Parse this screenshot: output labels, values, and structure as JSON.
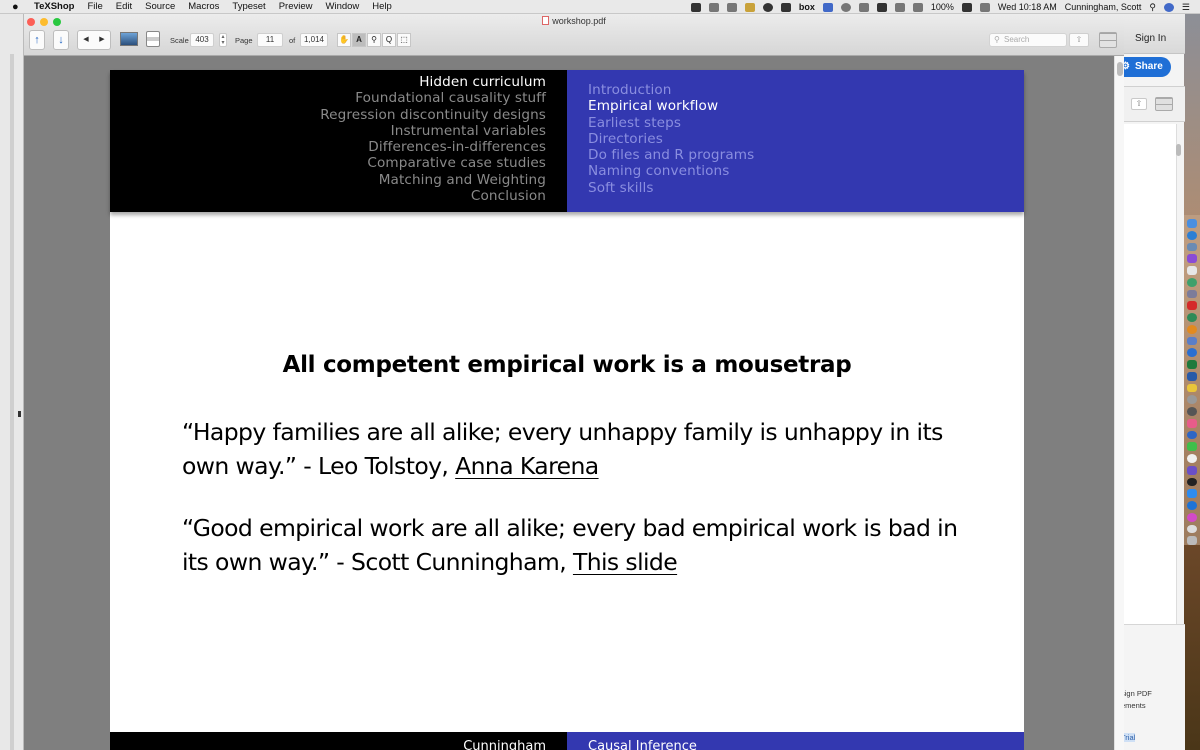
{
  "menubar": {
    "apple": "",
    "app_name": "TeXShop",
    "items": [
      "File",
      "Edit",
      "Source",
      "Macros",
      "Typeset",
      "Preview",
      "Window",
      "Help"
    ],
    "battery": "100%",
    "clock": "Wed 10:18 AM",
    "user": "Cunningham, Scott",
    "box_label": "box"
  },
  "window": {
    "title": "workshop.pdf",
    "toolbar": {
      "scale_label": "Scale",
      "scale_value": "403",
      "page_label": "Page",
      "page_value": "11",
      "of_label": "of",
      "page_total": "1,014",
      "search_placeholder": "Search",
      "prev_glyph": "◀",
      "next_glyph": "▶",
      "up_glyph": "↑",
      "down_glyph": "↓",
      "tools": [
        "✋",
        "A",
        "🔍︎",
        "Q",
        "⬚"
      ]
    }
  },
  "slide": {
    "sections_left": [
      {
        "label": "Hidden curriculum",
        "current": true
      },
      {
        "label": "Foundational causality stuff",
        "current": false
      },
      {
        "label": "Regression discontinuity designs",
        "current": false
      },
      {
        "label": "Instrumental variables",
        "current": false
      },
      {
        "label": "Differences-in-differences",
        "current": false
      },
      {
        "label": "Comparative case studies",
        "current": false
      },
      {
        "label": "Matching and Weighting",
        "current": false
      },
      {
        "label": "Conclusion",
        "current": false
      }
    ],
    "subsections_right": [
      {
        "label": "Introduction",
        "current": false
      },
      {
        "label": "Empirical workflow",
        "current": true
      },
      {
        "label": "Earliest steps",
        "current": false
      },
      {
        "label": "Directories",
        "current": false
      },
      {
        "label": "Do files and R programs",
        "current": false
      },
      {
        "label": "Naming conventions",
        "current": false
      },
      {
        "label": "Soft skills",
        "current": false
      }
    ],
    "title": "All competent empirical work is a mousetrap",
    "quote1": {
      "text": "“Happy families are all alike; every unhappy family is unhappy in its own way.”  - Leo Tolstoy, ",
      "source": "Anna Karena"
    },
    "quote2": {
      "text": "“Good empirical work are all alike; every bad empirical work is bad in its own way.”  - Scott Cunningham, ",
      "source": "This slide"
    },
    "footer_left": "Cunningham",
    "footer_right": "Causal Inference",
    "colors": {
      "header_left_bg": "#000000",
      "header_right_bg": "#3338b0"
    }
  },
  "right_window": {
    "sign_in": "Sign In",
    "share": "Share",
    "partial_text_1": "sign PDF",
    "partial_text_2": "ements",
    "partial_link": "Trial"
  }
}
